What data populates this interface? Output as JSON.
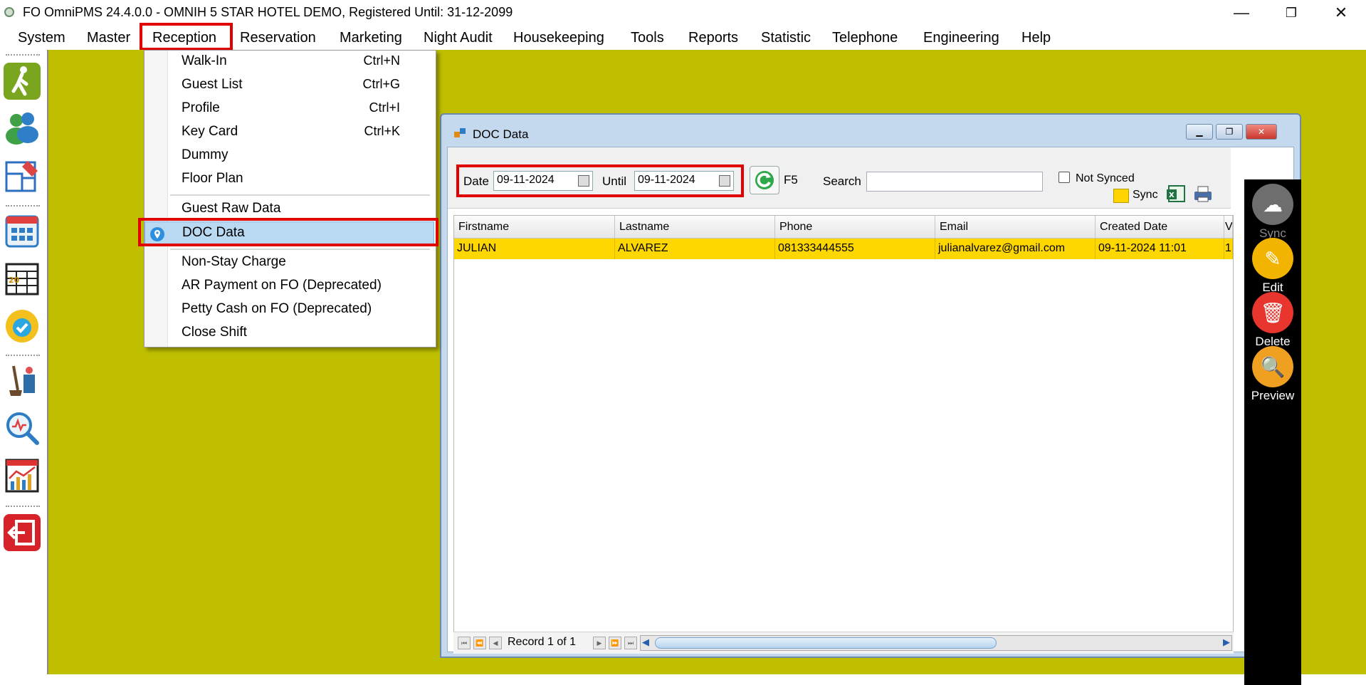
{
  "window": {
    "title": "FO OmniPMS 24.4.0.0 - OMNIH 5 STAR HOTEL DEMO, Registered Until: 31-12-2099",
    "controls": {
      "minimize": "—",
      "maximize": "❐",
      "close": "✕"
    }
  },
  "menubar": {
    "items": [
      "System",
      "Master",
      "Reception",
      "Reservation",
      "Marketing",
      "Night Audit",
      "Housekeeping",
      "Tools",
      "Reports",
      "Statistic",
      "Telephone",
      "Engineering",
      "Help"
    ]
  },
  "reception_menu": {
    "items": [
      {
        "label": "Walk-In",
        "shortcut": "Ctrl+N"
      },
      {
        "label": "Guest List",
        "shortcut": "Ctrl+G"
      },
      {
        "label": "Profile",
        "shortcut": "Ctrl+I"
      },
      {
        "label": "Key Card",
        "shortcut": "Ctrl+K"
      },
      {
        "label": "Dummy",
        "shortcut": ""
      },
      {
        "label": "Floor Plan",
        "shortcut": ""
      },
      {
        "label": "Guest Raw Data",
        "shortcut": ""
      },
      {
        "label": "DOC Data",
        "shortcut": ""
      },
      {
        "label": "Non-Stay Charge",
        "shortcut": ""
      },
      {
        "label": "AR Payment on FO (Deprecated)",
        "shortcut": ""
      },
      {
        "label": "Petty Cash on FO (Deprecated)",
        "shortcut": ""
      },
      {
        "label": "Close Shift",
        "shortcut": ""
      }
    ]
  },
  "doc_window": {
    "title": "DOC Data",
    "filters": {
      "date_label": "Date",
      "date_value": "09-11-2024",
      "until_label": "Until",
      "until_value": "09-11-2024",
      "refresh_label": "F5",
      "search_label": "Search",
      "search_value": "",
      "not_synced_label": "Not Synced",
      "sync_legend_label": "Sync"
    },
    "table": {
      "columns": [
        "Firstname",
        "Lastname",
        "Phone",
        "Email",
        "Created Date",
        "V"
      ],
      "rows": [
        [
          "JULIAN",
          "ALVAREZ",
          "081333444555",
          "julianalvarez@gmail.com",
          "09-11-2024 11:01",
          "1"
        ]
      ]
    },
    "navigator": {
      "record_text": "Record 1 of 1"
    },
    "actions": {
      "sync": "Sync",
      "edit": "Edit",
      "delete": "Delete",
      "preview": "Preview"
    }
  },
  "colors": {
    "desktop": "#bfbf00",
    "highlight_row": "#ffd700",
    "annotation_box": "#e00000"
  }
}
